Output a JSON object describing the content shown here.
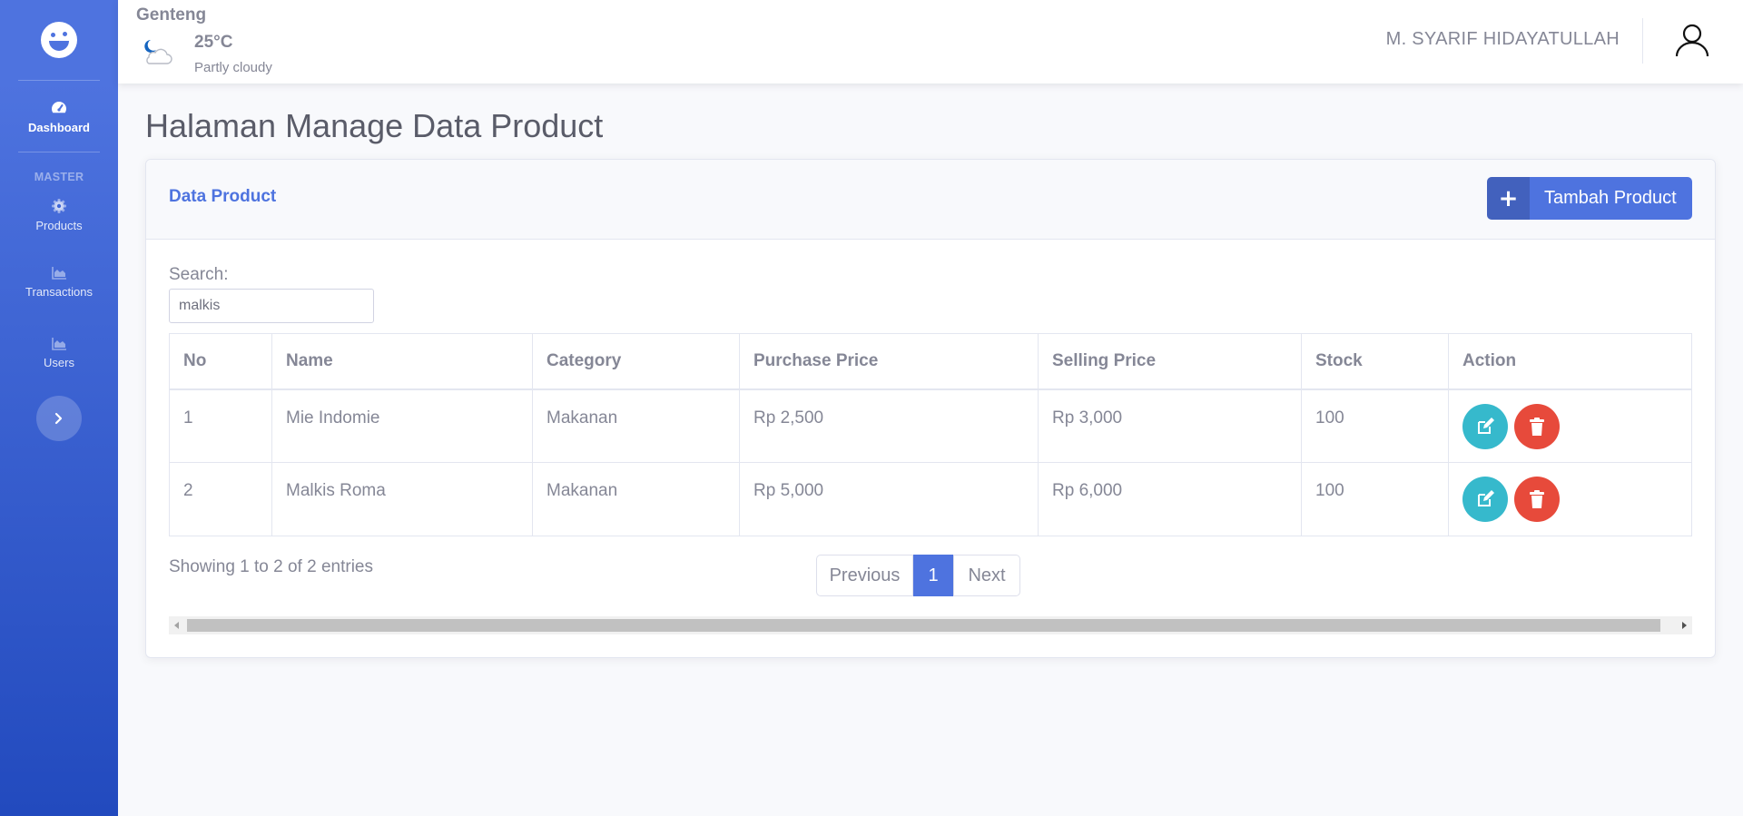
{
  "sidebar": {
    "brand_icon": "smile-wink-icon",
    "items": [
      {
        "label": "Dashboard",
        "icon": "tachometer-icon",
        "active": true
      },
      {
        "label": "Products",
        "icon": "cog-icon"
      },
      {
        "label": "Transactions",
        "icon": "chart-area-icon"
      },
      {
        "label": "Users",
        "icon": "chart-area-icon"
      }
    ],
    "heading": "MASTER",
    "toggle_icon": "chevron-right-icon"
  },
  "topbar": {
    "weather": {
      "city": "Genteng",
      "temperature": "25°C",
      "condition": "Partly cloudy",
      "icon": "moon-cloud-icon"
    },
    "username": "M. SYARIF HIDAYATULLAH",
    "user_icon": "user-icon"
  },
  "page": {
    "title": "Halaman Manage Data Product"
  },
  "card": {
    "title": "Data Product",
    "add_button": {
      "label": "Tambah Product",
      "icon": "plus-icon"
    },
    "search": {
      "label": "Search:",
      "value": "malkis"
    },
    "table": {
      "columns": [
        "No",
        "Name",
        "Category",
        "Purchase Price",
        "Selling Price",
        "Stock",
        "Action"
      ],
      "rows": [
        [
          "1",
          "Mie Indomie",
          "Makanan",
          "Rp 2,500",
          "Rp 3,000",
          "100"
        ],
        [
          "2",
          "Malkis Roma",
          "Makanan",
          "Rp 5,000",
          "Rp 6,000",
          "100"
        ]
      ]
    },
    "info": "Showing 1 to 2 of 2 entries",
    "pagination": {
      "previous": "Previous",
      "current": "1",
      "next": "Next"
    }
  },
  "colors": {
    "primary": "#4e73df",
    "info": "#36b9cc",
    "danger": "#e74a3b",
    "text": "#858796"
  }
}
